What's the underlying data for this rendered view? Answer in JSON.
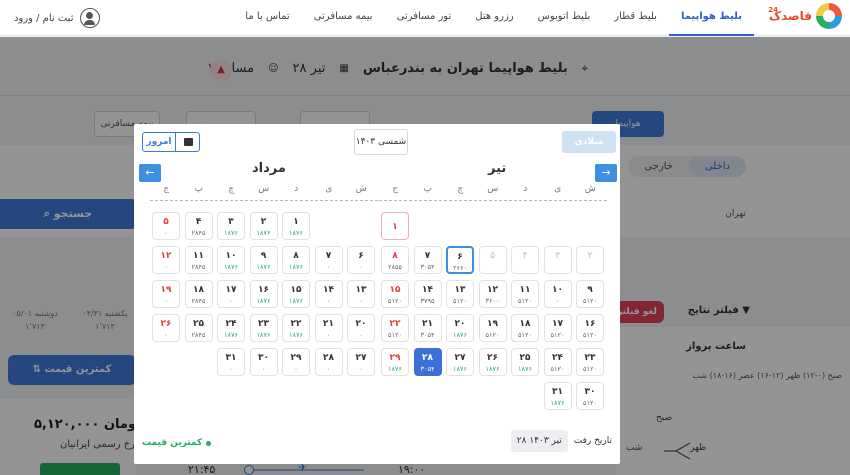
{
  "header": {
    "logo_text": "قاصدک",
    "logo_sup": "24",
    "nav": [
      "بلیط هواپیما",
      "بلیط قطار",
      "بلیط اتوبوس",
      "رزرو هتل",
      "تور مسافرتی",
      "بیمه مسافرتی",
      "تماس با ما"
    ],
    "active_nav": "بلیط هواپیما",
    "login_label": "ثبت نام / ورود"
  },
  "summary": {
    "route": "بلیط هواپیما تهران به بندرعباس",
    "date": "۲۸ تیر",
    "passengers": "۱ مسافر"
  },
  "background": {
    "tab_right": "هواپیما",
    "tab_left": "بیمه مسافرتی",
    "domestic": "داخلی",
    "foreign": "خارجی",
    "search_button": "جستجو",
    "origin": "تهران",
    "date_strip": [
      {
        "day": "دوشنبه ۰۵/۰۱",
        "price": "۱٬۷۱۳"
      },
      {
        "day": "یکشنبه ۰۴/۳۱",
        "price": "۱٬۷۱۳"
      }
    ],
    "cheapest_tab": "کمترین قیمت",
    "ticket_price": "۵,۱۲۰,۰۰۰ تومان",
    "ticket_airline": "نرخ رسمی ایرانیان",
    "time_depart": "۲۱:۴۵",
    "time_arrive": "۱۹:۰۰",
    "filter_title": "فیلتر نتایج",
    "cancel_badge": "لغو فیلتر",
    "flight_time": "ساعت پرواز",
    "time_ranges": "صبح (۰-۱۲) ظهر (۱۲-۱۶) عصر (۱۶-۱۸) شب",
    "dial_morning": "صبح",
    "dial_noon": "ظهر",
    "dial_night": "شب"
  },
  "calendar": {
    "today_button": "امروز",
    "year": "۱۴۰۳ شمسی",
    "gregorian_button": "میلادی",
    "months": [
      {
        "name": "تیر",
        "weekdays": [
          "ش",
          "ی",
          "د",
          "س",
          "چ",
          "پ",
          "ج"
        ],
        "days": [
          {
            "n": "۱",
            "p": "",
            "state": "circle",
            "row": 0,
            "col": 6
          },
          {
            "n": "۲",
            "p": "",
            "state": "past",
            "row": 1,
            "col": 0
          },
          {
            "n": "۳",
            "p": "",
            "state": "past",
            "row": 1,
            "col": 1
          },
          {
            "n": "۴",
            "p": "",
            "state": "past",
            "row": 1,
            "col": 2
          },
          {
            "n": "۵",
            "p": "",
            "state": "past",
            "row": 1,
            "col": 3
          },
          {
            "n": "۶",
            "p": "۲۶۶۰",
            "state": "today",
            "row": 1,
            "col": 4
          },
          {
            "n": "۷",
            "p": "۳۰۵۴",
            "state": "normal",
            "row": 1,
            "col": 5
          },
          {
            "n": "۸",
            "p": "۲۸۵۵",
            "state": "holiday",
            "row": 1,
            "col": 6
          },
          {
            "n": "۹",
            "p": "۵۱۲۰",
            "state": "normal",
            "row": 2,
            "col": 0
          },
          {
            "n": "۱۰",
            "p": "۰",
            "state": "normal",
            "row": 2,
            "col": 1
          },
          {
            "n": "۱۱",
            "p": "۵۱۲۰",
            "state": "normal",
            "row": 2,
            "col": 2
          },
          {
            "n": "۱۲",
            "p": "۳۶۰۰",
            "state": "normal",
            "row": 2,
            "col": 3
          },
          {
            "n": "۱۳",
            "p": "۵۱۲۰",
            "state": "normal",
            "row": 2,
            "col": 4
          },
          {
            "n": "۱۴",
            "p": "۳۷۹۵",
            "state": "normal",
            "row": 2,
            "col": 5
          },
          {
            "n": "۱۵",
            "p": "۵۱۲۰",
            "state": "holiday",
            "row": 2,
            "col": 6
          },
          {
            "n": "۱۶",
            "p": "۵۱۲۰",
            "state": "normal",
            "row": 3,
            "col": 0
          },
          {
            "n": "۱۷",
            "p": "۵۱۲۰",
            "state": "normal",
            "row": 3,
            "col": 1
          },
          {
            "n": "۱۸",
            "p": "۵۱۲۰",
            "state": "normal",
            "row": 3,
            "col": 2
          },
          {
            "n": "۱۹",
            "p": "۵۱۲۰",
            "state": "normal",
            "row": 3,
            "col": 3
          },
          {
            "n": "۲۰",
            "p": "۱۸۷۶",
            "state": "cheap",
            "row": 3,
            "col": 4
          },
          {
            "n": "۲۱",
            "p": "۳۰۵۴",
            "state": "normal",
            "row": 3,
            "col": 5
          },
          {
            "n": "۲۲",
            "p": "۵۱۲۰",
            "state": "holiday",
            "row": 3,
            "col": 6
          },
          {
            "n": "۲۳",
            "p": "۵۱۲۰",
            "state": "normal",
            "row": 4,
            "col": 0
          },
          {
            "n": "۲۴",
            "p": "۵۱۲۰",
            "state": "normal",
            "row": 4,
            "col": 1
          },
          {
            "n": "۲۵",
            "p": "۱۸۷۶",
            "state": "cheap",
            "row": 4,
            "col": 2
          },
          {
            "n": "۲۶",
            "p": "۱۸۷۶",
            "state": "cheap",
            "row": 4,
            "col": 3
          },
          {
            "n": "۲۷",
            "p": "۱۸۷۶",
            "state": "cheap",
            "row": 4,
            "col": 4
          },
          {
            "n": "۲۸",
            "p": "۳۰۵۴",
            "state": "selected",
            "row": 4,
            "col": 5
          },
          {
            "n": "۲۹",
            "p": "۱۸۷۶",
            "state": "holiday cheap",
            "row": 4,
            "col": 6
          },
          {
            "n": "۳۰",
            "p": "۵۱۲۰",
            "state": "normal",
            "row": 5,
            "col": 0
          },
          {
            "n": "۳۱",
            "p": "۱۸۷۶",
            "state": "cheap",
            "row": 5,
            "col": 1
          }
        ]
      },
      {
        "name": "مرداد",
        "weekdays": [
          "ش",
          "ی",
          "د",
          "س",
          "چ",
          "پ",
          "ج"
        ],
        "days": [
          {
            "n": "۱",
            "p": "۱۸۷۶",
            "state": "cheap",
            "row": 0,
            "col": 2
          },
          {
            "n": "۲",
            "p": "۱۸۷۶",
            "state": "cheap",
            "row": 0,
            "col": 3
          },
          {
            "n": "۳",
            "p": "۱۸۷۶",
            "state": "cheap",
            "row": 0,
            "col": 4
          },
          {
            "n": "۴",
            "p": "۲۸۴۵",
            "state": "normal",
            "row": 0,
            "col": 5
          },
          {
            "n": "۵",
            "p": "۰",
            "state": "holiday",
            "row": 0,
            "col": 6
          },
          {
            "n": "۶",
            "p": "۰",
            "state": "normal",
            "row": 1,
            "col": 0
          },
          {
            "n": "۷",
            "p": "۰",
            "state": "normal",
            "row": 1,
            "col": 1
          },
          {
            "n": "۸",
            "p": "۱۸۷۶",
            "state": "cheap",
            "row": 1,
            "col": 2
          },
          {
            "n": "۹",
            "p": "۱۸۷۶",
            "state": "cheap",
            "row": 1,
            "col": 3
          },
          {
            "n": "۱۰",
            "p": "۱۸۷۶",
            "state": "cheap",
            "row": 1,
            "col": 4
          },
          {
            "n": "۱۱",
            "p": "۲۸۴۵",
            "state": "normal",
            "row": 1,
            "col": 5
          },
          {
            "n": "۱۲",
            "p": "۰",
            "state": "holiday",
            "row": 1,
            "col": 6
          },
          {
            "n": "۱۳",
            "p": "۰",
            "state": "normal",
            "row": 2,
            "col": 0
          },
          {
            "n": "۱۴",
            "p": "۰",
            "state": "normal",
            "row": 2,
            "col": 1
          },
          {
            "n": "۱۵",
            "p": "۱۸۷۶",
            "state": "cheap",
            "row": 2,
            "col": 2
          },
          {
            "n": "۱۶",
            "p": "۱۸۷۶",
            "state": "cheap",
            "row": 2,
            "col": 3
          },
          {
            "n": "۱۷",
            "p": "۰",
            "state": "normal",
            "row": 2,
            "col": 4
          },
          {
            "n": "۱۸",
            "p": "۲۸۴۵",
            "state": "normal",
            "row": 2,
            "col": 5
          },
          {
            "n": "۱۹",
            "p": "۰",
            "state": "holiday",
            "row": 2,
            "col": 6
          },
          {
            "n": "۲۰",
            "p": "۰",
            "state": "normal",
            "row": 3,
            "col": 0
          },
          {
            "n": "۲۱",
            "p": "۰",
            "state": "normal",
            "row": 3,
            "col": 1
          },
          {
            "n": "۲۲",
            "p": "۱۸۷۶",
            "state": "cheap",
            "row": 3,
            "col": 2
          },
          {
            "n": "۲۳",
            "p": "۱۸۷۶",
            "state": "cheap",
            "row": 3,
            "col": 3
          },
          {
            "n": "۲۴",
            "p": "۱۸۷۶",
            "state": "cheap",
            "row": 3,
            "col": 4
          },
          {
            "n": "۲۵",
            "p": "۲۸۴۵",
            "state": "normal",
            "row": 3,
            "col": 5
          },
          {
            "n": "۲۶",
            "p": "۰",
            "state": "holiday",
            "row": 3,
            "col": 6
          },
          {
            "n": "۲۷",
            "p": "۰",
            "state": "normal",
            "row": 4,
            "col": 0
          },
          {
            "n": "۲۸",
            "p": "۰",
            "state": "normal",
            "row": 4,
            "col": 1
          },
          {
            "n": "۲۹",
            "p": "۰",
            "state": "normal",
            "row": 4,
            "col": 2
          },
          {
            "n": "۳۰",
            "p": "۰",
            "state": "normal",
            "row": 4,
            "col": 3
          },
          {
            "n": "۳۱",
            "p": "۰",
            "state": "normal",
            "row": 4,
            "col": 4
          }
        ]
      }
    ],
    "footer_label": "تاریخ رفت",
    "footer_value": "۲۸ تیر ۱۴۰۳",
    "legend": "کمترین قیمت"
  }
}
